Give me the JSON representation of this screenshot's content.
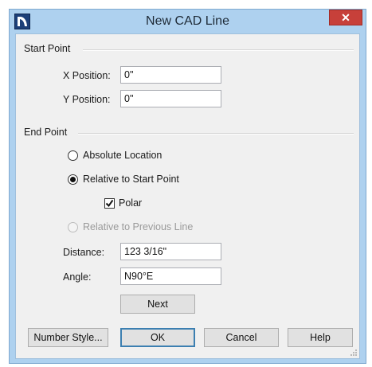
{
  "window": {
    "title": "New CAD Line",
    "close_glyph": "✕"
  },
  "start_point": {
    "group_label": "Start Point",
    "x_label": "X Position:",
    "x_value": "0\"",
    "y_label": "Y Position:",
    "y_value": "0\""
  },
  "end_point": {
    "group_label": "End Point",
    "absolute_label": "Absolute Location",
    "relative_start_label": "Relative to Start Point",
    "polar_label": "Polar",
    "relative_previous_label": "Relative to Previous Line",
    "distance_label": "Distance:",
    "distance_value": "123 3/16\"",
    "angle_label": "Angle:",
    "angle_value": "N90°E",
    "next_label": "Next"
  },
  "buttons": {
    "number_style": "Number Style...",
    "ok": "OK",
    "cancel": "Cancel",
    "help": "Help"
  },
  "state": {
    "selected_radio": "relative-to-start-point",
    "polar_checked": true,
    "relative_previous_enabled": false
  },
  "colors": {
    "window_frame": "#aed1ef",
    "close_button": "#c7403a",
    "dialog_bg": "#f0f0f0"
  },
  "icons": [
    "app-icon",
    "close-icon",
    "checkmark-icon",
    "resize-grip-icon"
  ]
}
